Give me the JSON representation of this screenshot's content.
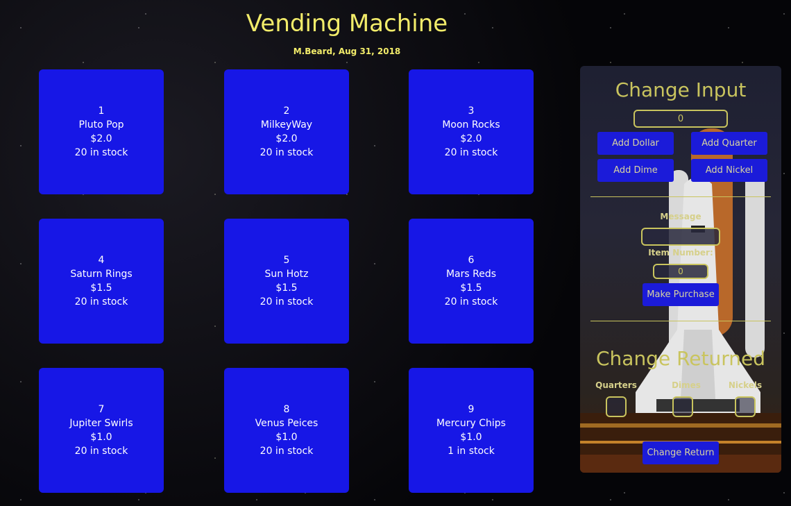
{
  "header": {
    "title": "Vending Machine",
    "subtitle": "M.Beard, Aug 31, 2018"
  },
  "items": [
    {
      "number": "1",
      "name": "Pluto Pop",
      "price": "$2.0",
      "stock": "20 in stock"
    },
    {
      "number": "2",
      "name": "MilkeyWay",
      "price": "$2.0",
      "stock": "20 in stock"
    },
    {
      "number": "3",
      "name": "Moon Rocks",
      "price": "$2.0",
      "stock": "20 in stock"
    },
    {
      "number": "4",
      "name": "Saturn Rings",
      "price": "$1.5",
      "stock": "20 in stock"
    },
    {
      "number": "5",
      "name": "Sun Hotz",
      "price": "$1.5",
      "stock": "20 in stock"
    },
    {
      "number": "6",
      "name": "Mars Reds",
      "price": "$1.5",
      "stock": "20 in stock"
    },
    {
      "number": "7",
      "name": "Jupiter Swirls",
      "price": "$1.0",
      "stock": "20 in stock"
    },
    {
      "number": "8",
      "name": "Venus Peices",
      "price": "$1.0",
      "stock": "20 in stock"
    },
    {
      "number": "9",
      "name": "Mercury Chips",
      "price": "$1.0",
      "stock": "1 in stock"
    }
  ],
  "panel": {
    "change_input_title": "Change Input",
    "money_value": "0",
    "add_dollar": "Add Dollar",
    "add_quarter": "Add Quarter",
    "add_dime": "Add Dime",
    "add_nickel": "Add Nickel",
    "message_label": "Message",
    "message_value": "",
    "item_number_label": "Item Number:",
    "item_number_value": "0",
    "make_purchase": "Make Purchase",
    "change_returned_title": "Change Returned",
    "quarters_label": "Quarters",
    "dimes_label": "Dimes",
    "nickels_label": "Nickels",
    "change_return": "Change Return"
  },
  "colors": {
    "title": "#f2ec6a",
    "item_bg": "#1717e6",
    "button_bg": "#1b1bd9",
    "panel_accent": "#c9c45e"
  }
}
